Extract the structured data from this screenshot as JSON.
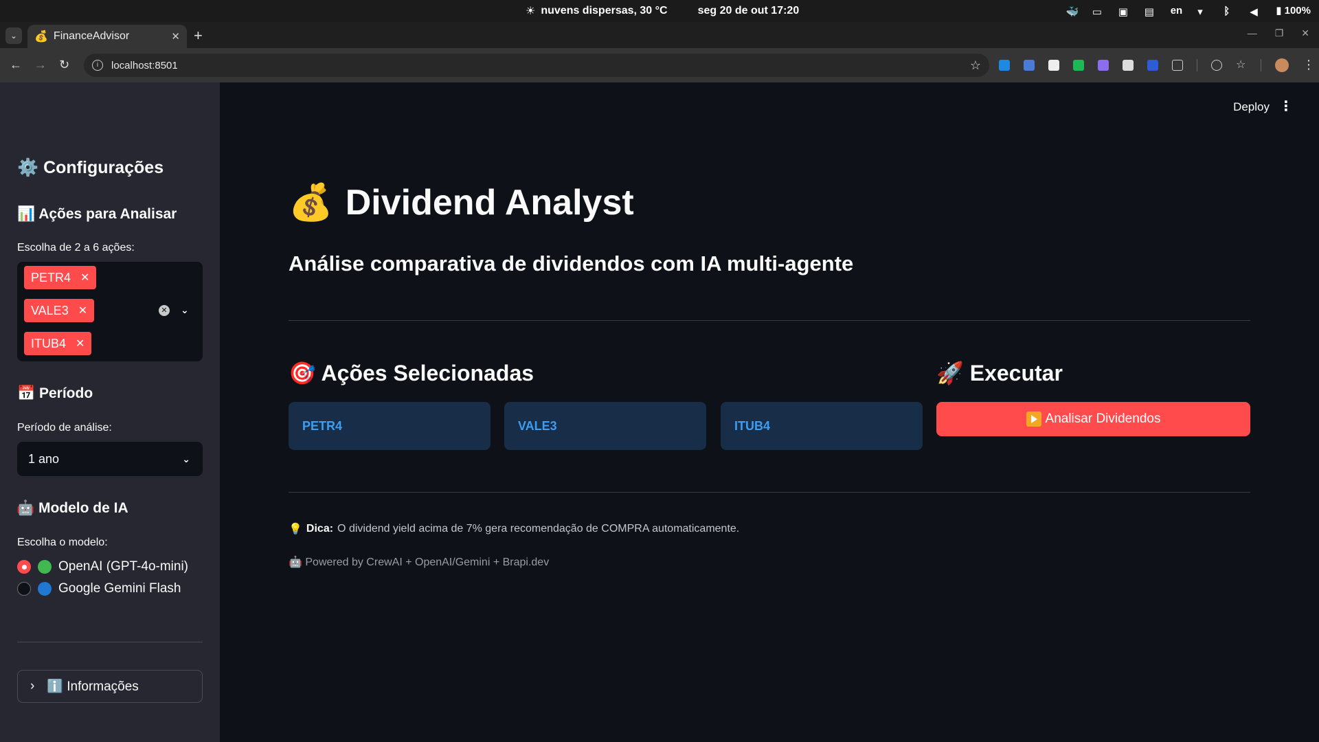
{
  "os": {
    "weather": "nuvens dispersas, 30 °C",
    "datetime": "seg 20 de out  17:20",
    "lang": "en",
    "battery": "100%"
  },
  "browser": {
    "tab_title": "FinanceAdvisor",
    "url": "localhost:8501"
  },
  "sidebar": {
    "settings_title": "⚙️ Configurações",
    "stocks_heading": "📊 Ações para Analisar",
    "stocks_label": "Escolha de 2 a 6 ações:",
    "selected_stocks": [
      "PETR4",
      "VALE3",
      "ITUB4"
    ],
    "period_heading": "📅 Período",
    "period_label": "Período de análise:",
    "period_value": "1 ano",
    "model_heading": "🤖 Modelo de IA",
    "model_label": "Escolha o modelo:",
    "models": [
      {
        "label": "OpenAI (GPT-4o-mini)",
        "color": "#3fb950",
        "selected": true
      },
      {
        "label": "Google Gemini Flash",
        "color": "#1f78d1",
        "selected": false
      }
    ],
    "info_expander": "ℹ️ Informações"
  },
  "header": {
    "deploy_label": "Deploy"
  },
  "main": {
    "title_icon": "💰",
    "title": "Dividend Analyst",
    "subtitle": "Análise comparativa de dividendos com IA multi-agente",
    "selected_title": "🎯 Ações Selecionadas",
    "execute_title": "🚀 Executar",
    "stock_cards": [
      "PETR4",
      "VALE3",
      "ITUB4"
    ],
    "run_button": "Analisar Dividendos",
    "tip_icon": "💡",
    "tip_bold": "Dica:",
    "tip_text": "O dividend yield acima de 7% gera recomendação de COMPRA automaticamente.",
    "credit": "🤖 Powered by CrewAI + OpenAI/Gemini + Brapi.dev"
  },
  "colors": {
    "accent": "#ff4b4b",
    "card_bg": "#172d48",
    "card_text": "#3d9df3"
  }
}
